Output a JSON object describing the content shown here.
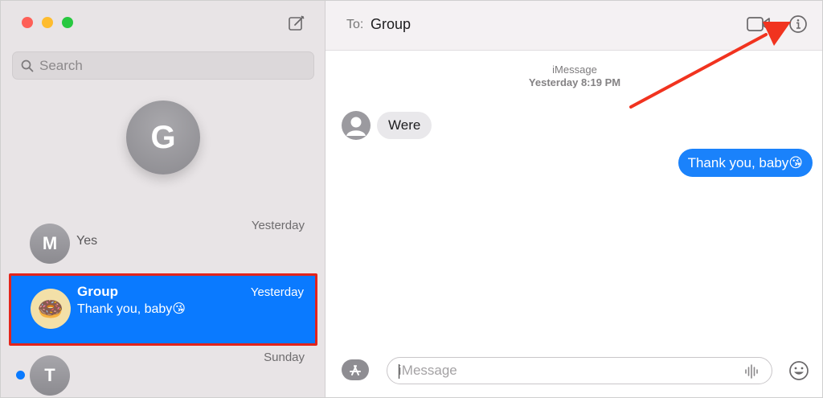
{
  "sidebar": {
    "search_placeholder": "Search",
    "pinned_initial": "G",
    "conversations": [
      {
        "initial": "M",
        "name": "",
        "preview": "Yes",
        "time": "Yesterday"
      },
      {
        "initial": "🍩",
        "name": "Group",
        "preview": "Thank you, baby😘",
        "time": "Yesterday",
        "selected": true
      },
      {
        "initial": "T",
        "name": "",
        "preview": "",
        "time": "Sunday",
        "unread": true
      }
    ]
  },
  "header": {
    "to_label": "To:",
    "recipient": "Group"
  },
  "thread": {
    "service": "iMessage",
    "timestamp": "Yesterday 8:19 PM",
    "incoming": "Were",
    "outgoing": "Thank you, baby😘"
  },
  "composer": {
    "placeholder": "iMessage"
  },
  "colors": {
    "accent": "#0a7aff",
    "highlight_border": "#e3241b",
    "annotation_arrow": "#f1331f"
  }
}
